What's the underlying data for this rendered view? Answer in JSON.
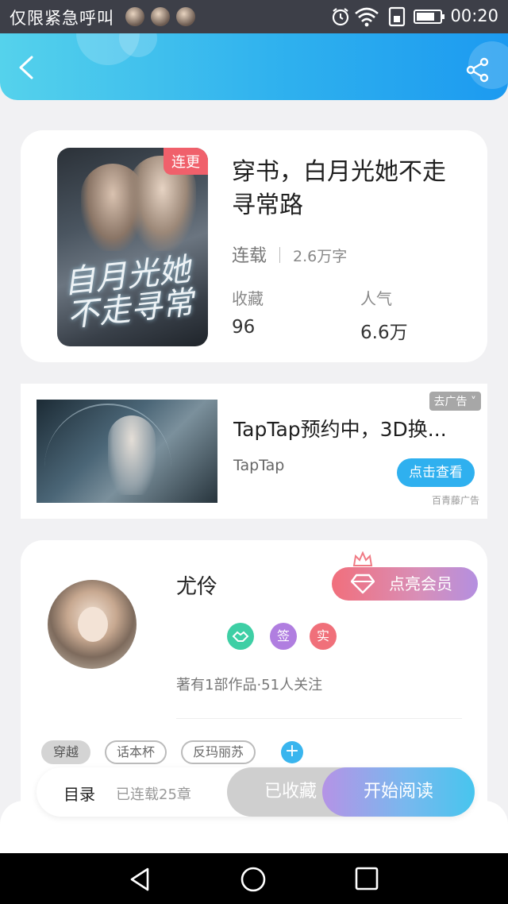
{
  "status_bar": {
    "carrier_text": "仅限紧急呼叫",
    "time": "00:20",
    "icons": [
      "alarm-icon",
      "wifi-icon",
      "sim-icon",
      "battery-icon"
    ]
  },
  "header": {
    "back_icon": "chevron-left-icon",
    "share_icon": "share-icon"
  },
  "book": {
    "badge": "连更",
    "title": "穿书，白月光她不走寻常路",
    "status": "连载",
    "word_count": "2.6万字",
    "stats": [
      {
        "label": "收藏",
        "value": "96"
      },
      {
        "label": "人气",
        "value": "6.6万"
      }
    ]
  },
  "ad": {
    "title": "TapTap预约中，3D换...",
    "brand": "TapTap",
    "close_label": "去广告 ˅",
    "cta_label": "点击查看",
    "source": "百青藤广告"
  },
  "author": {
    "name": "尤伶",
    "vip_label": "点亮会员",
    "badges": [
      {
        "name": "handshake-badge",
        "text": "",
        "color": "#3ecfa5"
      },
      {
        "name": "sign-badge",
        "text": "签",
        "color": "#b07ee0"
      },
      {
        "name": "verified-badge",
        "text": "实",
        "color": "#f0707a"
      }
    ],
    "stats_text": "著有1部作品·51人关注",
    "tags": [
      "穿越",
      "话本杯",
      "反玛丽苏"
    ],
    "add_tag_label": "+"
  },
  "action_bar": {
    "toc_label": "目录",
    "toc_count": "已连载25章",
    "collect_label": "已收藏",
    "read_label": "开始阅读"
  },
  "colors": {
    "accent": "#2fb1ee",
    "serial_badge": "#f0606b",
    "vip_gradient_start": "#f16f7c",
    "read_gradient_start": "#b593e6",
    "read_gradient_end": "#47c5ee"
  }
}
